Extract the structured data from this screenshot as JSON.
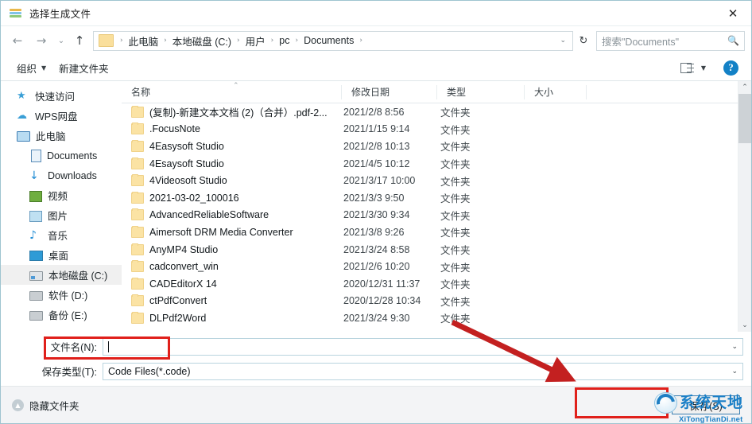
{
  "window": {
    "title": "选择生成文件",
    "icon": "books-stack-icon",
    "close_label": "✕"
  },
  "address_bar": {
    "back_label": "←",
    "forward_label": "→",
    "history_label": "⌄",
    "up_label": "↑",
    "folder_icon": "folder-icon",
    "crumbs": [
      "此电脑",
      "本地磁盘 (C:)",
      "用户",
      "pc",
      "Documents"
    ],
    "separator": "›",
    "dropdown_label": "⌄",
    "refresh_label": "↻",
    "search": {
      "placeholder": "搜索\"Documents\"",
      "icon": "search-icon"
    }
  },
  "toolbar": {
    "organize_label": "组织",
    "organize_caret": "▼",
    "new_folder_label": "新建文件夹",
    "view_caret": "▼",
    "help_label": "?"
  },
  "sidebar": {
    "items": [
      {
        "label": "快速访问",
        "icon": "star-icon",
        "level": 0,
        "selected": false
      },
      {
        "label": "WPS网盘",
        "icon": "cloud-icon",
        "level": 0,
        "selected": false
      },
      {
        "label": "此电脑",
        "icon": "computer-icon",
        "level": 0,
        "selected": false
      },
      {
        "label": "Documents",
        "icon": "document-icon",
        "level": 1,
        "selected": false
      },
      {
        "label": "Downloads",
        "icon": "download-icon",
        "level": 1,
        "selected": false
      },
      {
        "label": "视频",
        "icon": "video-icon",
        "level": 1,
        "selected": false
      },
      {
        "label": "图片",
        "icon": "picture-icon",
        "level": 1,
        "selected": false
      },
      {
        "label": "音乐",
        "icon": "music-icon",
        "level": 1,
        "selected": false
      },
      {
        "label": "桌面",
        "icon": "desktop-icon",
        "level": 1,
        "selected": false
      },
      {
        "label": "本地磁盘 (C:)",
        "icon": "drive-system-icon",
        "level": 1,
        "selected": true
      },
      {
        "label": "软件 (D:)",
        "icon": "drive-icon",
        "level": 1,
        "selected": false
      },
      {
        "label": "备份 (E:)",
        "icon": "drive-icon",
        "level": 1,
        "selected": false
      }
    ]
  },
  "file_list": {
    "columns": [
      "名称",
      "修改日期",
      "类型",
      "大小"
    ],
    "sort_indicator": "⌃",
    "rows": [
      {
        "name": "(复制)-新建文本文档 (2)（合并）.pdf-2...",
        "date": "2021/2/8 8:56",
        "type": "文件夹",
        "size": ""
      },
      {
        "name": ".FocusNote",
        "date": "2021/1/15 9:14",
        "type": "文件夹",
        "size": ""
      },
      {
        "name": "4Easysoft Studio",
        "date": "2021/2/8 10:13",
        "type": "文件夹",
        "size": ""
      },
      {
        "name": "4Esaysoft Studio",
        "date": "2021/4/5 10:12",
        "type": "文件夹",
        "size": ""
      },
      {
        "name": "4Videosoft Studio",
        "date": "2021/3/17 10:00",
        "type": "文件夹",
        "size": ""
      },
      {
        "name": "2021-03-02_100016",
        "date": "2021/3/3 9:50",
        "type": "文件夹",
        "size": ""
      },
      {
        "name": "AdvancedReliableSoftware",
        "date": "2021/3/30 9:34",
        "type": "文件夹",
        "size": ""
      },
      {
        "name": "Aimersoft DRM Media Converter",
        "date": "2021/3/8 9:26",
        "type": "文件夹",
        "size": ""
      },
      {
        "name": "AnyMP4 Studio",
        "date": "2021/3/24 8:58",
        "type": "文件夹",
        "size": ""
      },
      {
        "name": "cadconvert_win",
        "date": "2021/2/6 10:20",
        "type": "文件夹",
        "size": ""
      },
      {
        "name": "CADEditorX 14",
        "date": "2020/12/31 11:37",
        "type": "文件夹",
        "size": ""
      },
      {
        "name": "ctPdfConvert",
        "date": "2020/12/28 10:34",
        "type": "文件夹",
        "size": ""
      },
      {
        "name": "DLPdf2Word",
        "date": "2021/3/24 9:30",
        "type": "文件夹",
        "size": ""
      }
    ],
    "scroll_up_label": "⌃",
    "scroll_down_label": "⌄"
  },
  "form": {
    "filename_label": "文件名(N):",
    "filename_value": "",
    "filename_caret": "⌄",
    "savetype_label": "保存类型(T):",
    "savetype_value": "Code Files(*.code)",
    "savetype_caret": "⌄"
  },
  "footer": {
    "hide_folders_label": "隐藏文件夹",
    "hide_folders_icon": "chevron-up-circle-icon",
    "save_label": "保存(S)"
  },
  "watermark": {
    "cn": "系统天地",
    "en": "XiTongTianDi.net",
    "logo": "recycle-swoosh-icon"
  },
  "annotations": {
    "filename_box": "red-highlight-box",
    "save_box": "red-highlight-box",
    "arrow": "red-arrow-pointing-to-save",
    "color": "#e0201b"
  }
}
